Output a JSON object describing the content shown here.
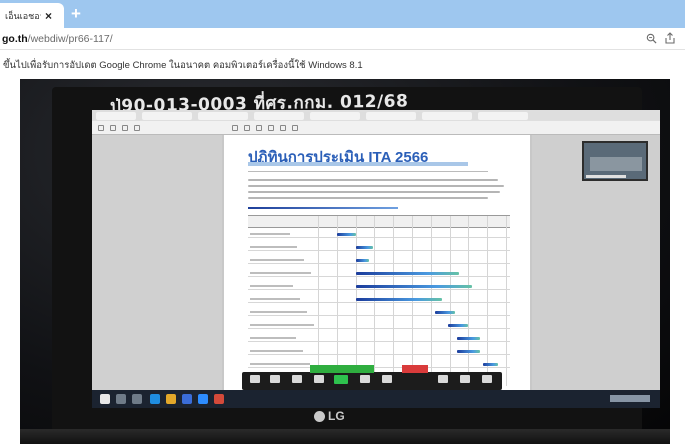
{
  "browser": {
    "tab": {
      "title": "เอ็นเอชอา",
      "close_glyph": "×"
    },
    "new_tab_glyph": "+",
    "url_host": "go.th",
    "url_path": "/webdiw/pr66-117/",
    "zoom_icon": "zoom-magnifier-icon",
    "share_icon": "share-icon",
    "tab_strip_color": "#9ec7ef"
  },
  "page": {
    "notice": "ขึ้นไปเพื่อรับการอัปเดต Google Chrome ในอนาคต คอมพิวเตอร์เครื่องนี้ใช้ Windows 8.1"
  },
  "photo": {
    "handwritten_label": "ป่90-013-0003 ที่ศร.กกม. 012/68",
    "document": {
      "title": "ปฏิทินการประเมิน ITA 2566",
      "accent_color": "#2b5fb8"
    },
    "gantt_rows": [
      {
        "start": 0.1,
        "end": 0.2
      },
      {
        "start": 0.2,
        "end": 0.29
      },
      {
        "start": 0.2,
        "end": 0.27
      },
      {
        "start": 0.2,
        "end": 0.75
      },
      {
        "start": 0.2,
        "end": 0.82
      },
      {
        "start": 0.2,
        "end": 0.66
      },
      {
        "start": 0.62,
        "end": 0.73
      },
      {
        "start": 0.69,
        "end": 0.8
      },
      {
        "start": 0.74,
        "end": 0.86
      },
      {
        "start": 0.74,
        "end": 0.86
      },
      {
        "start": 0.88,
        "end": 0.96
      }
    ],
    "brand": "LG"
  }
}
